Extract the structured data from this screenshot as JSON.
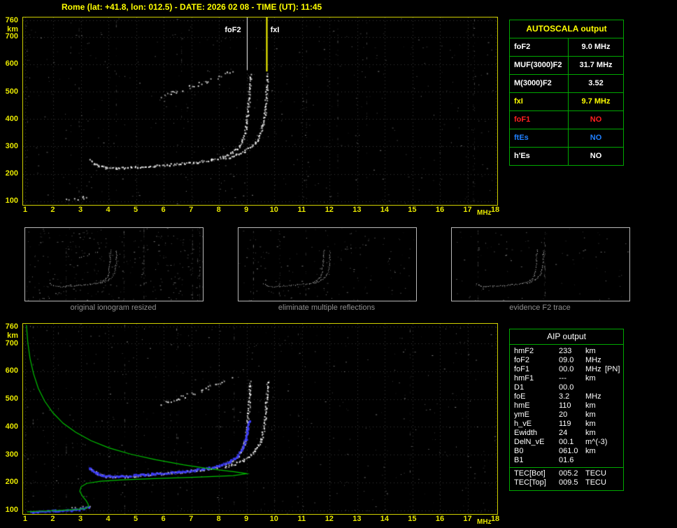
{
  "title": "Rome (lat: +41.8, lon: 012.5) - DATE: 2026 02 08 - TIME (UT): 11:45",
  "colors": {
    "background": "#000000",
    "plot_border": "#cfcf00",
    "table_border": "#00a800",
    "axis_text": "#e8e800",
    "title_text": "#ffff00",
    "trace_white": "#ffffff",
    "trace_blue": "#3b3bff",
    "profile_green": "#00c000",
    "fxI_yellow": "#ffff00",
    "foF1_red": "#ff2020",
    "ftEs_blue": "#2080ff",
    "caption_gray": "#8f8f8f"
  },
  "autoscala": {
    "header": "AUTOSCALA output",
    "rows": [
      {
        "label": "foF2",
        "value": "9.0 MHz",
        "color": "#ffffff"
      },
      {
        "label": "MUF(3000)F2",
        "value": "31.7 MHz",
        "color": "#ffffff"
      },
      {
        "label": "M(3000)F2",
        "value": "3.52",
        "color": "#ffffff"
      },
      {
        "label": "fxI",
        "value": "9.7 MHz",
        "color": "#ffff00"
      },
      {
        "label": "foF1",
        "value": "NO",
        "color": "#ff2020"
      },
      {
        "label": "ftEs",
        "value": "NO",
        "color": "#2080ff"
      },
      {
        "label": "h'Es",
        "value": "NO",
        "color": "#ffffff"
      }
    ]
  },
  "aip": {
    "header": "AIP output",
    "rows": [
      {
        "label": "hmF2",
        "value": "233",
        "unit": "km"
      },
      {
        "label": "foF2",
        "value": "09.0",
        "unit": "MHz"
      },
      {
        "label": "foF1",
        "value": "00.0",
        "unit": "MHz",
        "extra": "[PN]"
      },
      {
        "label": "hmF1",
        "value": "---",
        "unit": "km"
      },
      {
        "label": "D1",
        "value": "00.0",
        "unit": ""
      },
      {
        "label": "foE",
        "value": "3.2",
        "unit": "MHz"
      },
      {
        "label": "hmE",
        "value": "110",
        "unit": "km"
      },
      {
        "label": "ymE",
        "value": "20",
        "unit": "km"
      },
      {
        "label": "h_vE",
        "value": "119",
        "unit": "km"
      },
      {
        "label": "Ewidth",
        "value": "24",
        "unit": "km"
      },
      {
        "label": "DelN_vE",
        "value": "00.1",
        "unit": "m^(-3)"
      },
      {
        "label": "B0",
        "value": "061.0",
        "unit": "km"
      },
      {
        "label": "B1",
        "value": "01.6",
        "unit": ""
      }
    ],
    "tec_rows": [
      {
        "label": "TEC[Bot]",
        "value": "005.2",
        "unit": "TECU"
      },
      {
        "label": "TEC[Top]",
        "value": "009.5",
        "unit": "TECU"
      }
    ]
  },
  "thumbnails": [
    {
      "caption": "original ionogram resized"
    },
    {
      "caption": "eliminate multiple reflections"
    },
    {
      "caption": "evidence F2 trace"
    }
  ],
  "chart_data": {
    "type": "scatter",
    "title": "Ionogram - Rome 2026 02 08 11:45 UT",
    "x_axis": {
      "label": "MHz",
      "ticks": [
        1,
        2,
        3,
        4,
        5,
        6,
        7,
        8,
        9,
        10,
        11,
        12,
        13,
        14,
        15,
        16,
        17,
        18
      ],
      "range": [
        0.9,
        18.05
      ]
    },
    "y_axis": {
      "label": "km",
      "ticks": [
        760,
        700,
        600,
        500,
        400,
        300,
        200,
        100
      ],
      "range": [
        88,
        772
      ]
    },
    "scaled_values": {
      "foF2_MHz": 9.0,
      "fxI_MHz": 9.7,
      "hmF2_km": 233,
      "foE_MHz": 3.2,
      "hmE_km": 110
    },
    "series_library": {
      "f2_ordinary": {
        "style": "dots",
        "color": "#ffffff",
        "points": [
          [
            3.3,
            252
          ],
          [
            3.6,
            233
          ],
          [
            3.9,
            225
          ],
          [
            4.3,
            222
          ],
          [
            4.8,
            226
          ],
          [
            5.4,
            231
          ],
          [
            6.0,
            235
          ],
          [
            6.6,
            240
          ],
          [
            7.2,
            246
          ],
          [
            7.7,
            254
          ],
          [
            8.1,
            264
          ],
          [
            8.45,
            280
          ],
          [
            8.7,
            302
          ],
          [
            8.85,
            330
          ],
          [
            8.95,
            368
          ],
          [
            9.0,
            415
          ],
          [
            9.05,
            465
          ],
          [
            9.08,
            520
          ],
          [
            9.12,
            570
          ]
        ]
      },
      "f2_extraordinary": {
        "style": "dots",
        "color": "#ffffff",
        "points": [
          [
            8.2,
            258
          ],
          [
            8.55,
            270
          ],
          [
            8.9,
            286
          ],
          [
            9.15,
            303
          ],
          [
            9.33,
            324
          ],
          [
            9.47,
            350
          ],
          [
            9.57,
            385
          ],
          [
            9.64,
            428
          ],
          [
            9.68,
            475
          ],
          [
            9.71,
            525
          ],
          [
            9.73,
            568
          ]
        ]
      },
      "multiple_reflections": {
        "style": "dots",
        "color": "#e8e8e8",
        "sparse": 0.5,
        "jitter": 2.2,
        "points": [
          [
            5.9,
            487
          ],
          [
            6.3,
            500
          ],
          [
            6.7,
            513
          ],
          [
            7.1,
            526
          ],
          [
            7.5,
            540
          ],
          [
            7.9,
            555
          ],
          [
            8.2,
            568
          ],
          [
            8.45,
            582
          ]
        ]
      },
      "e_region": {
        "style": "dots",
        "color": "#dddddd",
        "sparse": 0.45,
        "jitter": 2.0,
        "points": [
          [
            2.3,
            107
          ],
          [
            2.6,
            111
          ],
          [
            2.9,
            109
          ],
          [
            3.1,
            116
          ],
          [
            3.3,
            111
          ]
        ]
      },
      "restored_trace": {
        "style": "dots",
        "color": "#3b3bff",
        "dot": 3,
        "jitter": 1.2,
        "points": [
          [
            3.25,
            258
          ],
          [
            3.5,
            238
          ],
          [
            3.8,
            228
          ],
          [
            4.2,
            225
          ],
          [
            4.7,
            228
          ],
          [
            5.2,
            232
          ],
          [
            5.8,
            236
          ],
          [
            6.4,
            241
          ],
          [
            7.0,
            247
          ],
          [
            7.5,
            254
          ],
          [
            7.95,
            263
          ],
          [
            8.3,
            277
          ],
          [
            8.6,
            297
          ],
          [
            8.8,
            325
          ],
          [
            8.93,
            360
          ],
          [
            9.0,
            400
          ],
          [
            9.05,
            428
          ]
        ]
      },
      "restored_trace_e": {
        "style": "dots",
        "color": "#3b3bff",
        "dot": 3,
        "jitter": 1.2,
        "points": [
          [
            1.15,
            99
          ],
          [
            1.7,
            101
          ],
          [
            2.3,
            103
          ],
          [
            2.8,
            106
          ],
          [
            3.1,
            110
          ],
          [
            3.25,
            117
          ]
        ]
      },
      "density_profile": {
        "style": "line",
        "color": "#00c000",
        "points": [
          [
            1.02,
            768
          ],
          [
            1.07,
            706
          ],
          [
            1.15,
            648
          ],
          [
            1.28,
            592
          ],
          [
            1.45,
            540
          ],
          [
            1.68,
            494
          ],
          [
            1.98,
            452
          ],
          [
            2.35,
            414
          ],
          [
            2.8,
            382
          ],
          [
            3.35,
            352
          ],
          [
            4.0,
            326
          ],
          [
            4.8,
            303
          ],
          [
            5.7,
            283
          ],
          [
            6.7,
            265
          ],
          [
            7.7,
            250
          ],
          [
            8.55,
            240
          ],
          [
            9.0,
            233
          ],
          [
            8.5,
            226
          ],
          [
            7.3,
            221
          ],
          [
            5.8,
            216
          ],
          [
            4.5,
            211
          ],
          [
            3.7,
            206
          ],
          [
            3.2,
            198
          ],
          [
            3.0,
            186
          ],
          [
            2.95,
            170
          ],
          [
            3.05,
            152
          ],
          [
            3.18,
            136
          ],
          [
            3.25,
            124
          ],
          [
            3.27,
            115
          ],
          [
            3.15,
            108
          ],
          [
            2.8,
            104
          ],
          [
            2.2,
            101
          ],
          [
            1.5,
            98
          ],
          [
            1.05,
            96
          ]
        ]
      }
    },
    "plots": [
      {
        "id": "top",
        "series": [
          "f2_ordinary",
          "f2_extraordinary",
          "multiple_reflections",
          "e_region"
        ],
        "noise": {
          "seed": 11,
          "count": 380,
          "streaks": 10
        },
        "annotations": [
          {
            "type": "vline",
            "x": 9.0,
            "to_km": 580,
            "color": "#ffffff",
            "width": 1
          },
          {
            "type": "vline",
            "x": 9.7,
            "to_km": 575,
            "color": "#ffff00",
            "width": 2
          },
          {
            "type": "label",
            "text": "foF2",
            "x": 8.22,
            "km": 726,
            "color": "#ffffff"
          },
          {
            "type": "label",
            "text": "fxI",
            "x": 9.87,
            "km": 726,
            "color": "#ffffff"
          }
        ]
      },
      {
        "id": "bottom",
        "series": [
          "f2_ordinary",
          "f2_extraordinary",
          "multiple_reflections",
          "e_region",
          "restored_trace",
          "restored_trace_e",
          "density_profile"
        ],
        "noise": {
          "seed": 23,
          "count": 380,
          "streaks": 10
        },
        "annotations": []
      },
      {
        "id": "thumb1",
        "series": [
          "f2_ordinary",
          "f2_extraordinary",
          "multiple_reflections",
          "e_region"
        ],
        "noise": {
          "seed": 31,
          "count": 300,
          "streaks": 6
        }
      },
      {
        "id": "thumb2",
        "series": [
          "f2_ordinary",
          "f2_extraordinary"
        ],
        "noise": {
          "seed": 41,
          "count": 150,
          "streaks": 4
        }
      },
      {
        "id": "thumb3",
        "series": [
          "f2_ordinary",
          "f2_extraordinary"
        ],
        "noise": {
          "seed": 53,
          "count": 90,
          "streaks": 3
        }
      }
    ]
  }
}
